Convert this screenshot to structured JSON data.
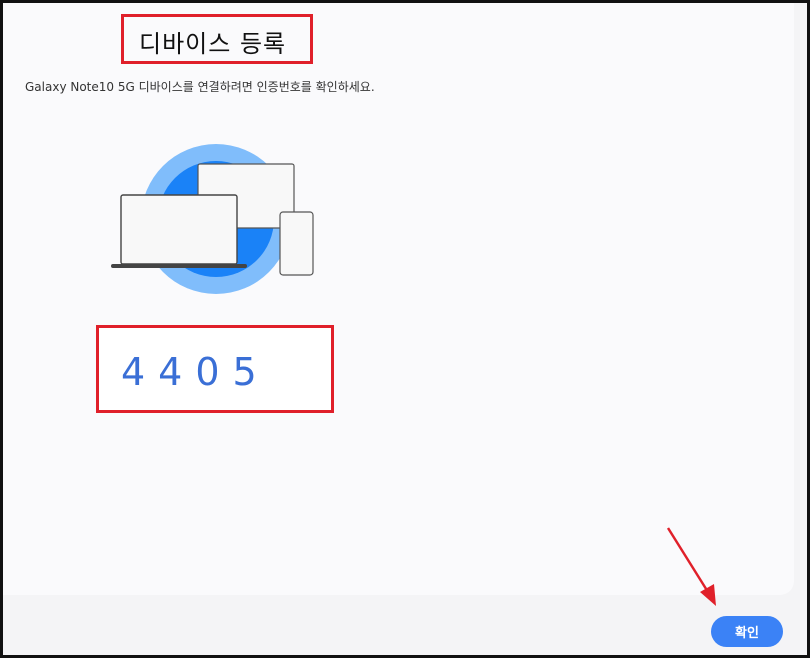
{
  "dialog": {
    "title": "디바이스 등록",
    "description": "Galaxy Note10 5G 디바이스를 연결하려면 인증번호를 확인하세요.",
    "code": "4405",
    "confirm_label": "확인"
  },
  "colors": {
    "accent": "#3b82f6",
    "code_text": "#3a6fd6",
    "highlight": "#e0202a",
    "circle_outer": "#80bdfb",
    "circle_inner": "#1a82f7"
  },
  "icons": [
    "devices-illustration",
    "arrow-annotation-icon"
  ]
}
